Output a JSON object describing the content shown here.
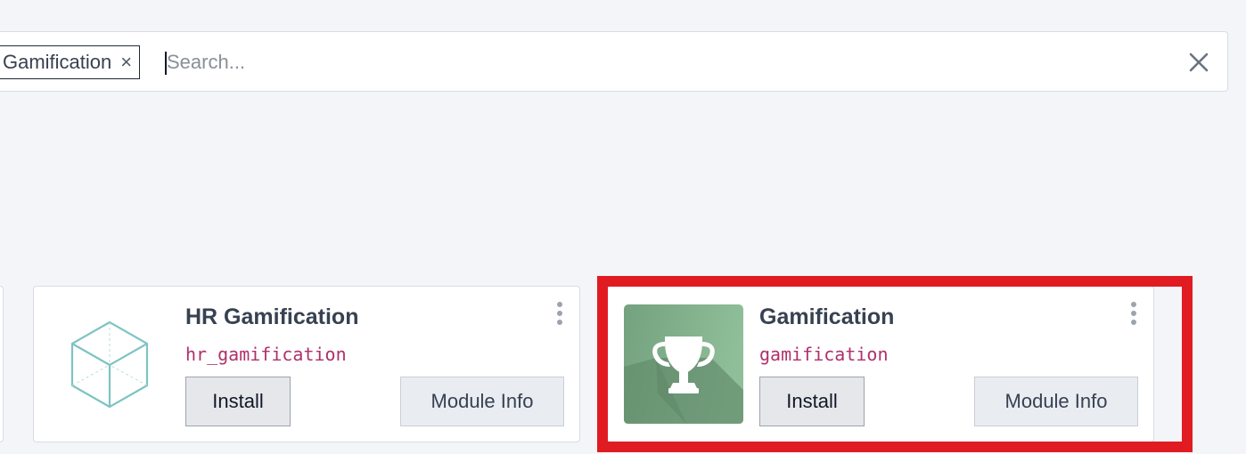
{
  "search": {
    "facet_label": "Gamification",
    "placeholder": "Search...",
    "value": ""
  },
  "modules": [
    {
      "title": "HR Gamification",
      "technical_name": "hr_gamification",
      "install_label": "Install",
      "info_label": "Module Info",
      "icon": "cube-icon"
    },
    {
      "title": "Gamification",
      "technical_name": "gamification",
      "install_label": "Install",
      "info_label": "Module Info",
      "icon": "trophy-icon"
    }
  ],
  "colors": {
    "background": "#f4f5f9",
    "technical_name": "#b0306b",
    "highlight": "#e11b22",
    "trophy_tile": "#6f9a7a"
  }
}
